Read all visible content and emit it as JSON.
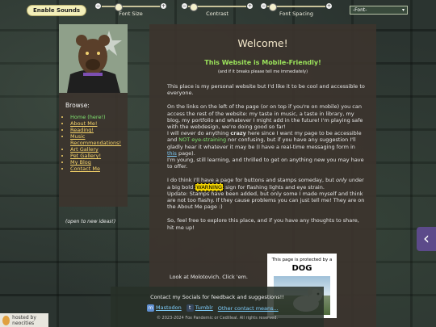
{
  "topbar": {
    "sound_button": "Enable Sounds",
    "sliders": [
      {
        "label": "Font Size",
        "minus": "−",
        "plus": "+"
      },
      {
        "label": "Contrast",
        "minus": "−",
        "plus": "+"
      },
      {
        "label": "Font Spacing",
        "minus": "−",
        "plus": "+"
      }
    ],
    "font_select": "-Font-"
  },
  "sidebar": {
    "browse_title": "Browse:",
    "items": [
      {
        "label": "Home",
        "suffix": " (here!)"
      },
      {
        "label": "About Me!"
      },
      {
        "label": "Reading!"
      },
      {
        "label": "Music Recommendations!"
      },
      {
        "label": "Art Gallery"
      },
      {
        "label": "Pet Gallery!"
      },
      {
        "label": "My Blog"
      },
      {
        "label": "Contact Me"
      }
    ],
    "open_note": "(open to new ideas!)"
  },
  "main": {
    "title": "Welcome!",
    "mobile": "This Website is Mobile-Friendly!",
    "mobile_note": "(and if it breaks please tell me immediately)",
    "p1": "This place is my personal website but I'd like it to be cool and accessible to everyone.",
    "p2a": "On the links on the left of the page (or on top if you're on mobile) you can access the rest of the website: my taste in music, a taste in library, my blog, my portfolio and whatever I might add in the future! I'm playing safe with the webdesign, we're doing good so far!",
    "p2b_1": "I will ",
    "p2b_never": "never",
    "p2b_2": " do anything ",
    "p2b_crazy": "crazy",
    "p2b_3": " here since I want my page to be accessible and ",
    "p2b_eye": "NOT eye-straining",
    "p2b_4": " nor confusing, but if you have any suggestion I'll gladly hear it whatever it may be (I have a real-time messaging form in ",
    "p2b_link": "this",
    "p2b_5": " page).",
    "p2c": "I'm young, still learning, and thrilled to get on anything new you may have to offer.",
    "p3_1": "I do think I'll have a page for buttons and stamps someday, but ",
    "p3_only": "only",
    "p3_2": " under a big bold ",
    "p3_warning": "WARNING",
    "p3_3": " sign for flashing lights and eye strain.",
    "p3_update": "Update: Stamps have been added, but only some I made myself and think are not too flashy. If they cause problems you can just tell me! They are on the About Me page :)",
    "p4": "So, feel free to explore this place, and if you have any thoughts to share, hit me up!",
    "look": "Look at Molotovich. Click 'em."
  },
  "dog_badge": {
    "line1": "This page is protected by a",
    "line2": "DOG"
  },
  "footer": {
    "contact": "Contact my Socials for feedback and suggestions!!",
    "mastodon": "Mastodon",
    "tumblr": "Tumblr",
    "other": "Other contact means...",
    "copyright": "© 2023-2024 Fox Pandemic or Cedilleal. All rights reserved."
  },
  "neocities": "hosted by neocities"
}
